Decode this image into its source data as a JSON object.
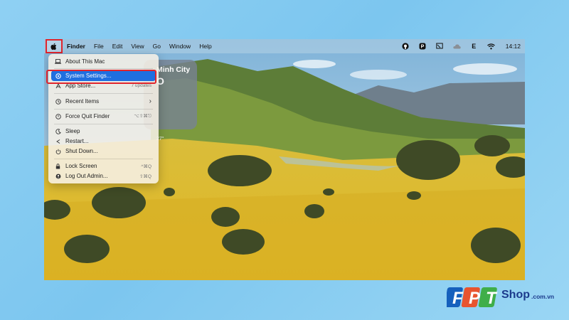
{
  "menubar": {
    "app_name": "Finder",
    "menus": [
      "File",
      "Edit",
      "View",
      "Go",
      "Window",
      "Help"
    ],
    "status_icons": [
      "github-icon",
      "pocket-icon",
      "tv-icon",
      "cloud-icon",
      "e-input-icon",
      "wifi-icon"
    ],
    "e_label": "E",
    "time": "14:12"
  },
  "weather_widget": {
    "city": "Minh City",
    "temp": "O",
    "range": "27°"
  },
  "apple_menu": {
    "items": [
      {
        "label": "About This Mac",
        "icon": "laptop-icon",
        "shortcut": ""
      },
      {
        "label": "System Settings...",
        "icon": "gear-icon",
        "shortcut": ""
      },
      {
        "label": "App Store...",
        "icon": "appstore-icon",
        "shortcut": "7 updates"
      },
      {
        "label": "Recent Items",
        "icon": "clock-icon",
        "shortcut": "›"
      },
      {
        "label": "Force Quit Finder",
        "icon": "force-quit-icon",
        "shortcut": "⌥⇧⌘⎋"
      },
      {
        "label": "Sleep",
        "icon": "moon-icon",
        "shortcut": ""
      },
      {
        "label": "Restart...",
        "icon": "restart-icon",
        "shortcut": ""
      },
      {
        "label": "Shut Down...",
        "icon": "power-icon",
        "shortcut": ""
      },
      {
        "label": "Lock Screen",
        "icon": "lock-icon",
        "shortcut": "^⌘Q"
      },
      {
        "label": "Log Out Admin...",
        "icon": "user-icon",
        "shortcut": "⇧⌘Q"
      }
    ],
    "highlight_color": "#1f6fe0",
    "annotation_color": "#e0252d"
  },
  "watermark": {
    "brand": "FPT",
    "shop": "Shop",
    "domain": ".com.vn"
  }
}
